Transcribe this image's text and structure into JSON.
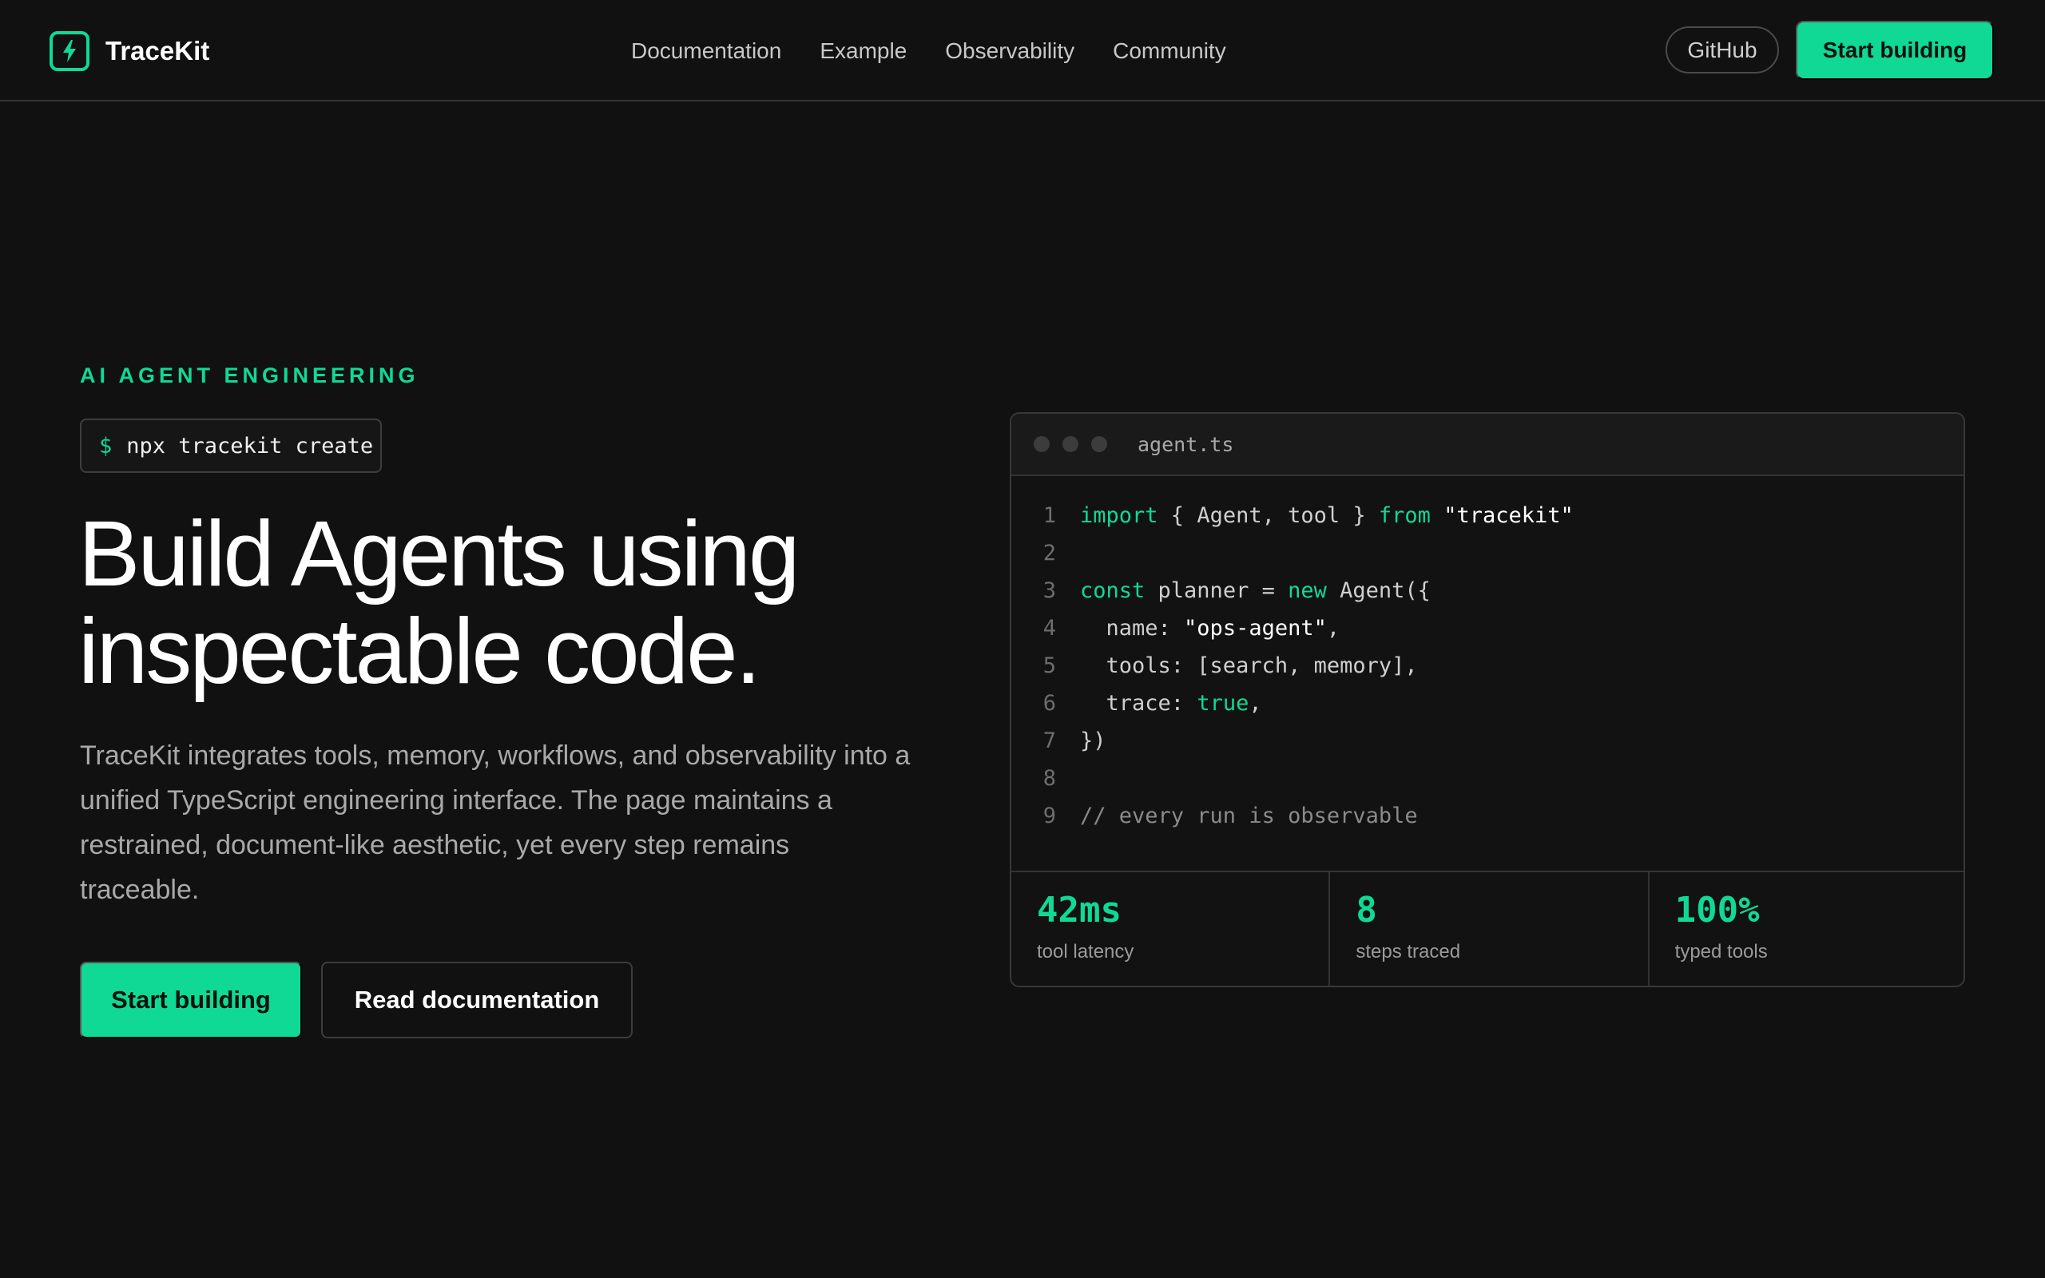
{
  "brand": {
    "name": "TraceKit"
  },
  "nav": {
    "links": [
      "Documentation",
      "Example",
      "Observability",
      "Community"
    ],
    "github_label": "GitHub",
    "start_label": "Start building"
  },
  "hero": {
    "eyebrow": "AI AGENT ENGINEERING",
    "command_prompt": "$",
    "command": "npx tracekit create",
    "headline_line1": "Build Agents using",
    "headline_line2": "inspectable code.",
    "subtext": "TraceKit integrates tools, memory, workflows, and observability into a unified TypeScript engineering interface. The page maintains a restrained, document-like aesthetic, yet every step remains traceable.",
    "primary_cta": "Start building",
    "secondary_cta": "Read documentation"
  },
  "editor": {
    "filename": "agent.ts",
    "lines": [
      {
        "num": "1",
        "tokens": [
          {
            "t": "import",
            "c": "kw"
          },
          {
            "t": " { Agent, tool } ",
            "c": ""
          },
          {
            "t": "from",
            "c": "kw"
          },
          {
            "t": " ",
            "c": ""
          },
          {
            "t": "\"tracekit\"",
            "c": "str"
          }
        ]
      },
      {
        "num": "2",
        "tokens": []
      },
      {
        "num": "3",
        "tokens": [
          {
            "t": "const",
            "c": "kw"
          },
          {
            "t": " planner = ",
            "c": ""
          },
          {
            "t": "new",
            "c": "kw"
          },
          {
            "t": " Agent({",
            "c": ""
          }
        ]
      },
      {
        "num": "4",
        "tokens": [
          {
            "t": "  name: ",
            "c": ""
          },
          {
            "t": "\"ops-agent\"",
            "c": "str"
          },
          {
            "t": ",",
            "c": ""
          }
        ]
      },
      {
        "num": "5",
        "tokens": [
          {
            "t": "  tools: [search, memory],",
            "c": ""
          }
        ]
      },
      {
        "num": "6",
        "tokens": [
          {
            "t": "  trace: ",
            "c": ""
          },
          {
            "t": "true",
            "c": "kw"
          },
          {
            "t": ",",
            "c": ""
          }
        ]
      },
      {
        "num": "7",
        "tokens": [
          {
            "t": "})",
            "c": ""
          }
        ]
      },
      {
        "num": "8",
        "tokens": []
      },
      {
        "num": "9",
        "tokens": [
          {
            "t": "// every run is observable",
            "c": "cm"
          }
        ]
      }
    ]
  },
  "stats": [
    {
      "value": "42ms",
      "label": "tool latency"
    },
    {
      "value": "8",
      "label": "steps traced"
    },
    {
      "value": "100%",
      "label": "typed tools"
    }
  ],
  "colors": {
    "accent": "#10d996",
    "background": "#111111"
  },
  "icons": {
    "logo": "bolt-icon"
  }
}
